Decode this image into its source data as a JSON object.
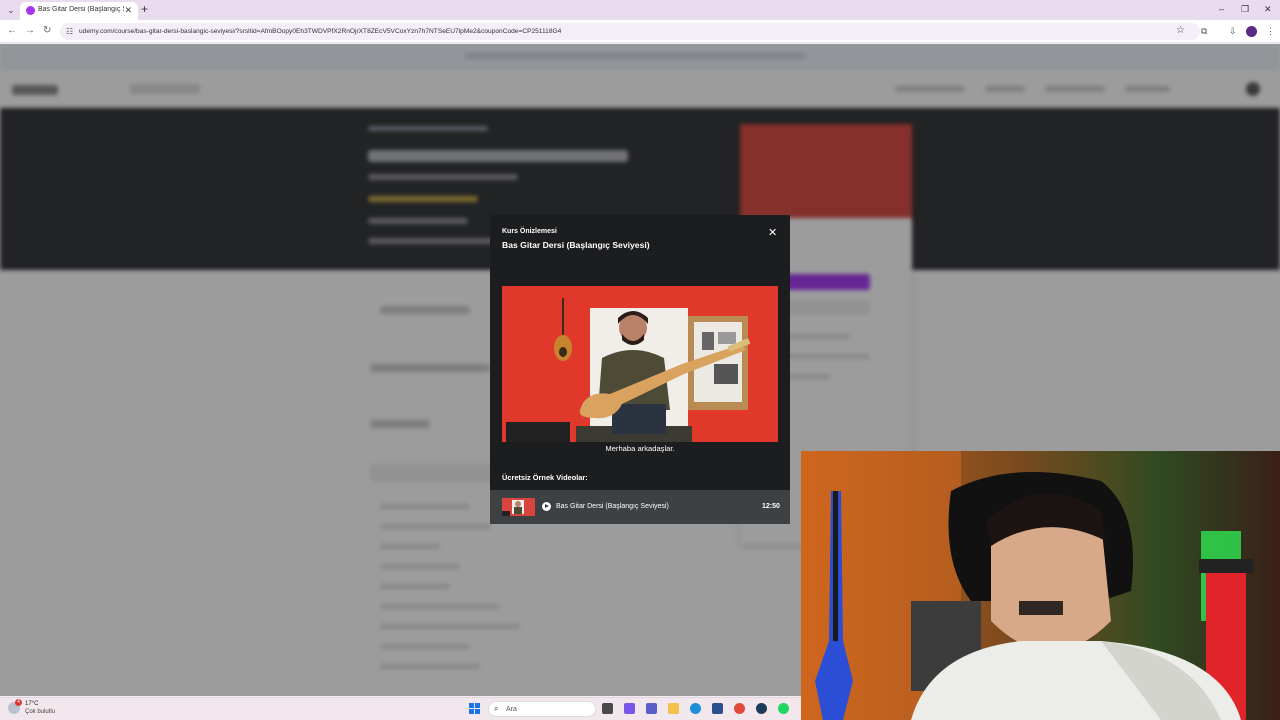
{
  "browser": {
    "tab_title": "Bas Gitar Dersi (Başlangıç Seviy",
    "url": "udemy.com/course/bas-gitar-dersi-baslangic-seviyesi/?srsltid=AfmBOopy0Eh3TWDVPfX2RnOjrXT8ZEcV5VCoxYzn7h7NTSeEU7lpMe2&couponCode=CP251118G4"
  },
  "modal": {
    "subtitle": "Kurs Önizlemesi",
    "title": "Bas Gitar Dersi (Başlangıç Seviyesi)",
    "caption": "Merhaba arkadaşlar.",
    "free_videos_label": "Ücretsiz Örnek Videolar:",
    "lesson": {
      "title": "Bas Gitar Dersi (Başlangıç Seviyesi)",
      "duration": "12:50"
    }
  },
  "taskbar": {
    "weather_temp": "17°C",
    "weather_desc": "Çok bulutlu",
    "weather_badge": "4",
    "search_placeholder": "Ara"
  },
  "colors": {
    "modal_bg": "#1c1d1f",
    "lesson_row_bg": "#3e4143",
    "video_bg": "#e0392c",
    "udemy_purple": "#a435f0"
  }
}
